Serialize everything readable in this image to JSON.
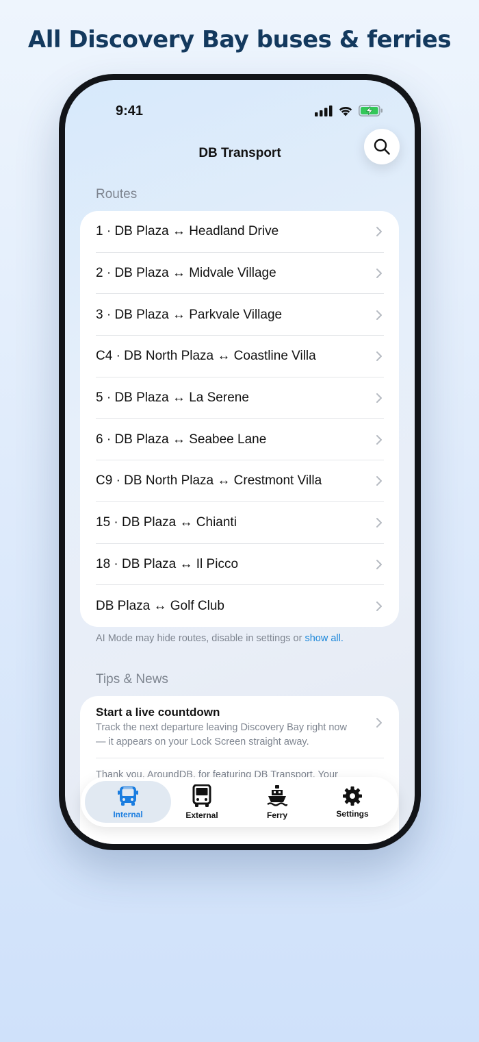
{
  "headline": "All Discovery Bay buses & ferries",
  "status": {
    "time": "9:41"
  },
  "nav": {
    "title": "DB Transport"
  },
  "routes": {
    "header": "Routes",
    "items": [
      {
        "label": "1 · DB Plaza ↔ Headland Drive"
      },
      {
        "label": "2 · DB Plaza ↔ Midvale Village"
      },
      {
        "label": "3 · DB Plaza ↔ Parkvale Village"
      },
      {
        "label": "C4 · DB North Plaza ↔ Coastline Villa"
      },
      {
        "label": "5 · DB Plaza ↔ La Serene"
      },
      {
        "label": "6 · DB Plaza ↔ Seabee Lane"
      },
      {
        "label": "C9 · DB North Plaza ↔ Crestmont Villa"
      },
      {
        "label": "15 · DB Plaza ↔ Chianti"
      },
      {
        "label": "18 · DB Plaza ↔ Il Picco"
      },
      {
        "label": "DB Plaza ↔ Golf Club"
      }
    ],
    "footnote_text": "AI Mode may hide routes, disable in settings or ",
    "footnote_link": "show all."
  },
  "tips": {
    "header": "Tips & News",
    "items": [
      {
        "title": "Start a live countdown",
        "body": "Track the next departure leaving Discovery Bay right now — it appears on your Lock Screen straight away."
      },
      {
        "body": "Thank you, AroundDB, for featuring DB Transport. Your"
      }
    ]
  },
  "tabbar": {
    "tabs": [
      {
        "label": "Internal",
        "icon": "bus-front-icon",
        "active": true
      },
      {
        "label": "External",
        "icon": "coach-icon",
        "active": false
      },
      {
        "label": "Ferry",
        "icon": "ferry-icon",
        "active": false
      },
      {
        "label": "Settings",
        "icon": "gear-icon",
        "active": false
      }
    ]
  },
  "colors": {
    "accent": "#1a7de0",
    "headline": "#13395e",
    "battery": "#34c759"
  }
}
